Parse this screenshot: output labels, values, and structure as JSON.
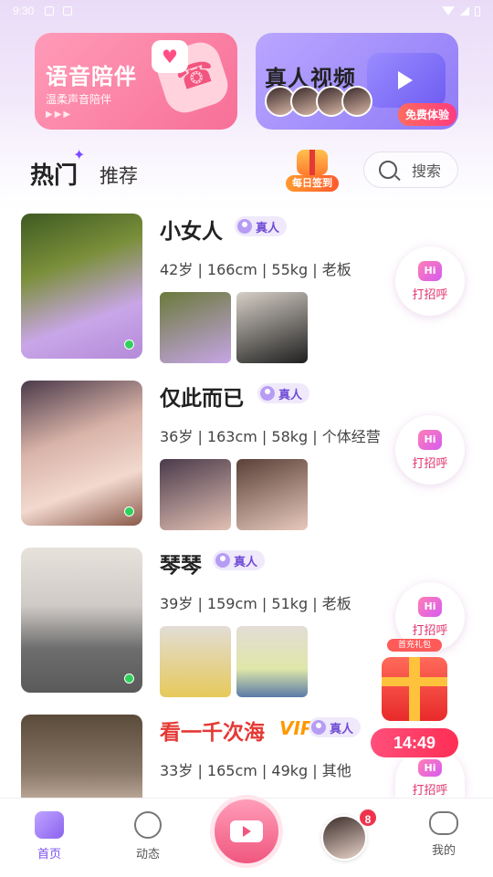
{
  "status_bar": {
    "time": "9:30"
  },
  "banners": {
    "voice": {
      "title": "语音陪伴",
      "subtitle": "温柔声音陪伴",
      "dots": "▶▶▶"
    },
    "video": {
      "title": "真人视频",
      "button": "免费体验"
    }
  },
  "tabs": {
    "hot": "热门",
    "recommend": "推荐"
  },
  "checkin": {
    "label": "每日签到"
  },
  "search": {
    "placeholder": "搜索"
  },
  "users": [
    {
      "name": "小女人",
      "verified": "真人",
      "info": "42岁 | 166cm | 55kg | 老板",
      "online": true,
      "greet": "打招呼",
      "hi": "Hi"
    },
    {
      "name": "仅此而已",
      "verified": "真人",
      "info": "36岁 | 163cm | 58kg | 个体经营",
      "online": true,
      "greet": "打招呼",
      "hi": "Hi"
    },
    {
      "name": "琴琴",
      "verified": "真人",
      "info": "39岁 | 159cm | 51kg | 老板",
      "online": true,
      "greet": "打招呼",
      "hi": "Hi"
    },
    {
      "name": "看一千次海",
      "verified": "真人",
      "vip": "VIP",
      "info": "33岁 | 165cm | 49kg | 其他",
      "greet": "打招呼",
      "hi": "Hi"
    }
  ],
  "gift": {
    "label": "首充礼包",
    "timer": "14:49"
  },
  "nav": {
    "home": "首页",
    "moments": "动态",
    "mine": "我的",
    "message_badge": "8"
  },
  "colors": {
    "accent": "#7b4ef0",
    "greet": "#e0356e",
    "online": "#2ed15a",
    "vip_name": "#e53935"
  }
}
